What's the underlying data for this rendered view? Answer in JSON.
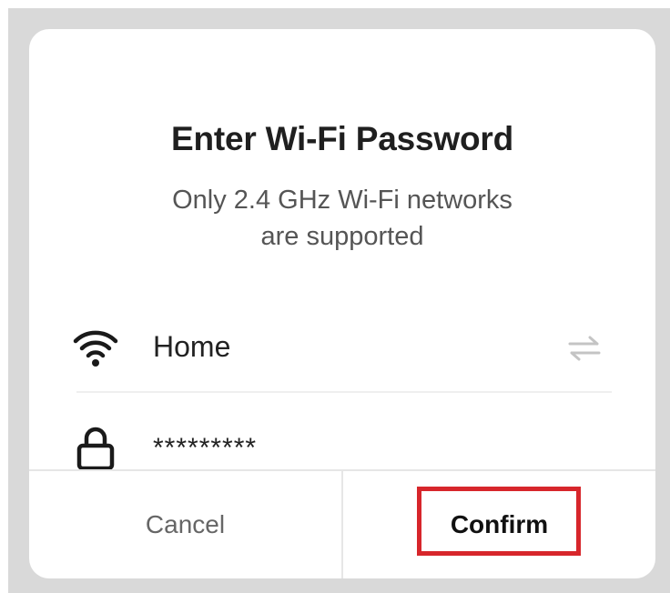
{
  "dialog": {
    "title": "Enter Wi-Fi Password",
    "subtitle_line1": "Only 2.4 GHz Wi-Fi networks",
    "subtitle_line2": "are supported"
  },
  "network": {
    "ssid": "Home",
    "password_masked": "*********"
  },
  "icons": {
    "ssid": "wifi-icon",
    "password": "lock-icon",
    "switch": "switch-network-icon"
  },
  "actions": {
    "cancel_label": "Cancel",
    "confirm_label": "Confirm"
  },
  "colors": {
    "highlight": "#d7262b",
    "background": "#d9d9d9",
    "dialog": "#ffffff"
  }
}
